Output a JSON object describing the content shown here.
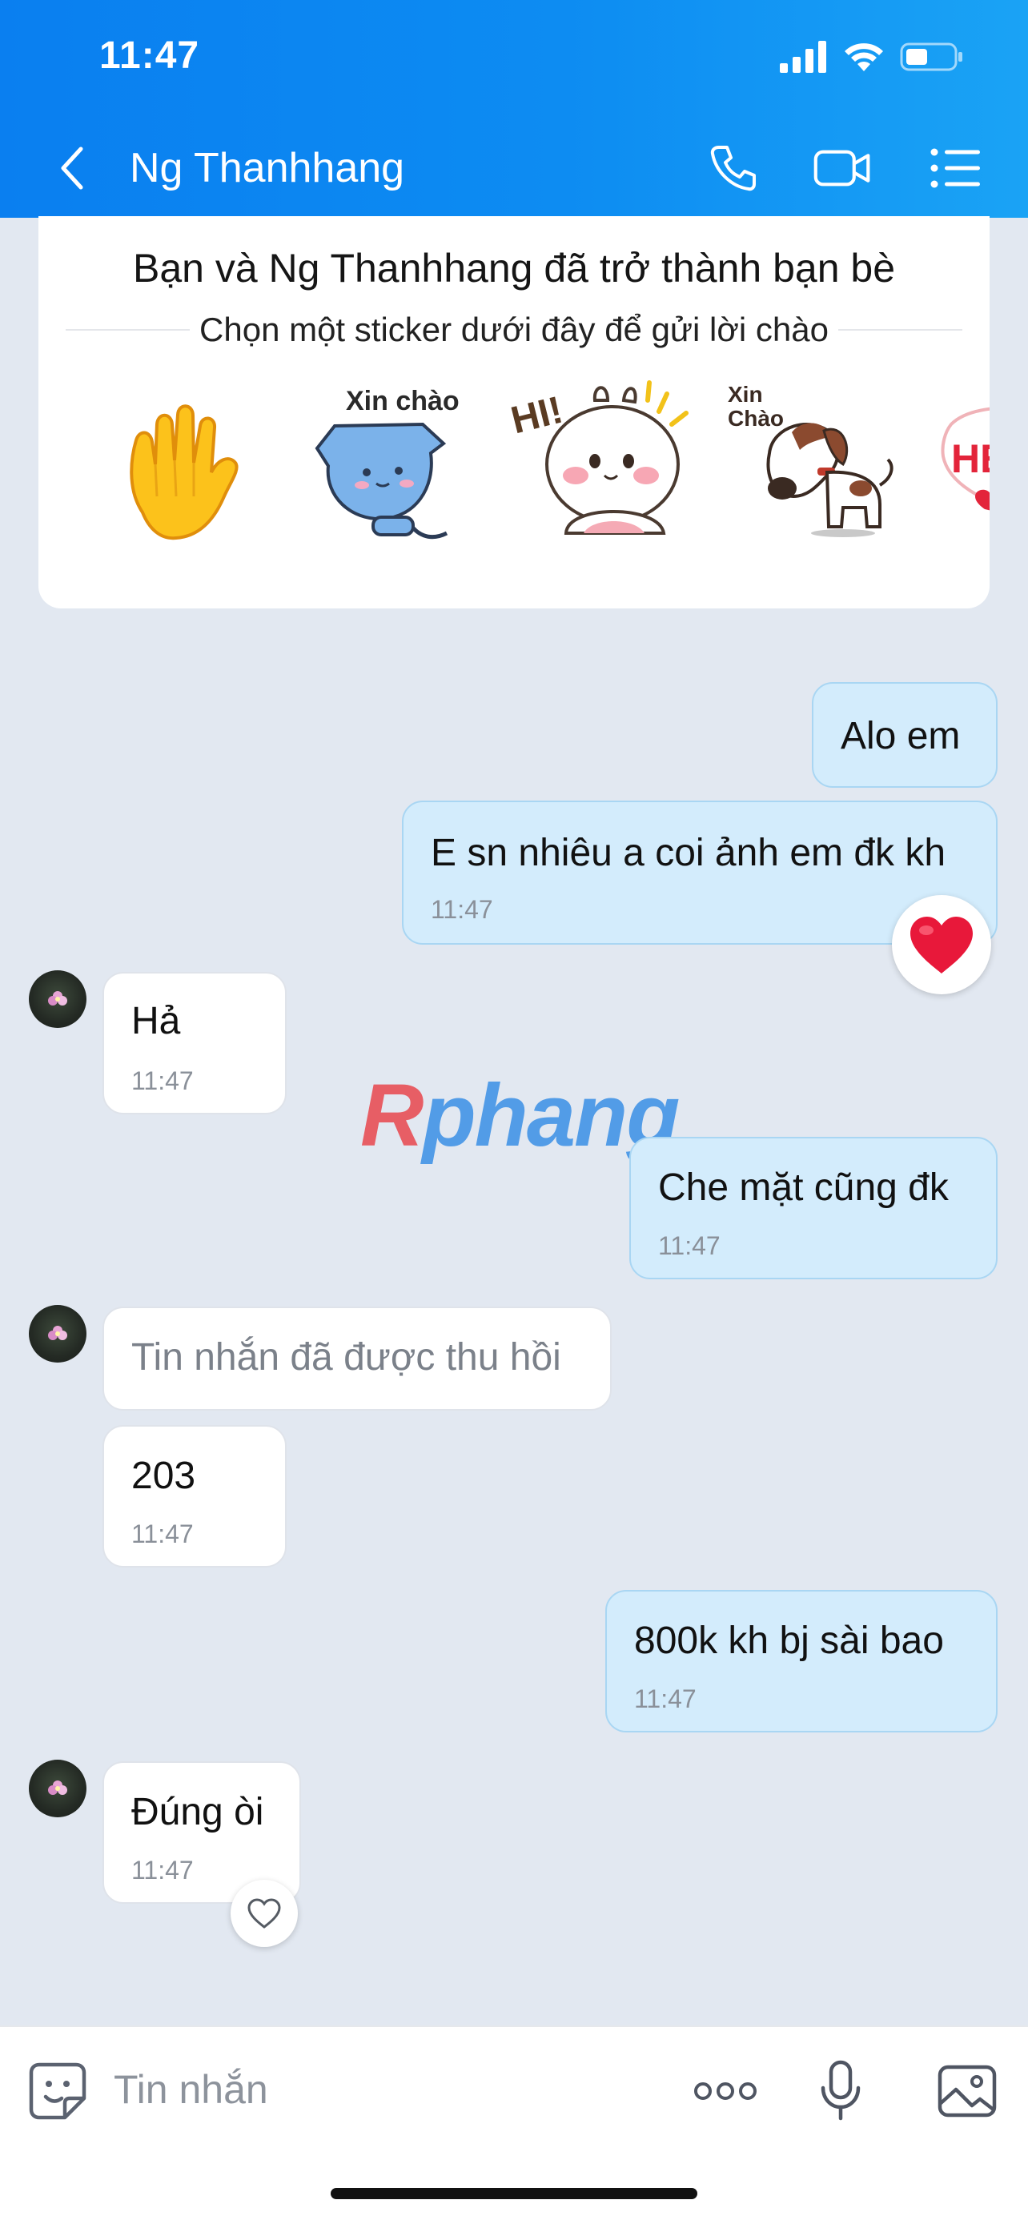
{
  "status_bar": {
    "time": "11:47"
  },
  "header": {
    "title": "Ng Thanhhang"
  },
  "friend_card": {
    "title": "Bạn và Ng Thanhhang đã trở thành bạn bè",
    "subtitle": "Chọn một sticker dưới đây để gửi lời chào",
    "stickers": [
      {
        "name": "waving-hand"
      },
      {
        "name": "blue-cat",
        "text": "Xin chào"
      },
      {
        "name": "white-bunny",
        "text": "HI!"
      },
      {
        "name": "brown-dog",
        "text": "Xin Chào"
      },
      {
        "name": "partial-sticker",
        "text": "HÉ"
      }
    ]
  },
  "messages": [
    {
      "side": "sent",
      "text": "Alo em"
    },
    {
      "side": "sent",
      "text": "E sn nhiêu a coi ảnh em đk kh",
      "time": "11:47",
      "reaction": "heart-filled"
    },
    {
      "side": "received",
      "text": "Hả",
      "time": "11:47"
    },
    {
      "side": "sent",
      "text": "Che mặt cũng đk",
      "time": "11:47"
    },
    {
      "side": "received",
      "text": "Tin nhắn đã được thu hồi",
      "recalled": true
    },
    {
      "side": "received",
      "text": "203",
      "time": "11:47"
    },
    {
      "side": "sent",
      "text": "800k kh bj sài bao",
      "time": "11:47"
    },
    {
      "side": "received",
      "text": "Đúng òi",
      "time": "11:47",
      "reaction": "heart-outline"
    }
  ],
  "watermark": {
    "first": "R",
    "rest": "phang"
  },
  "composer": {
    "placeholder": "Tin nhắn"
  },
  "colors": {
    "header_start": "#0a7ff0",
    "header_end": "#1aa3f5",
    "chat_background": "#e2e8f1",
    "sent_bubble": "#d3ecfc",
    "received_bubble": "#ffffff",
    "reaction_heart": "#e8183a"
  }
}
